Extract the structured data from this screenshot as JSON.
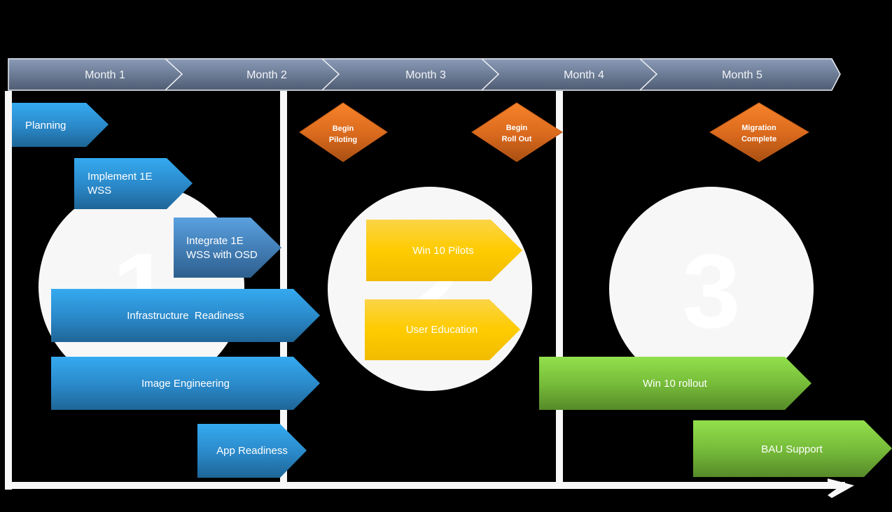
{
  "timeline": {
    "months": [
      "Month 1",
      "Month 2",
      "Month 3",
      "Month 4",
      "Month 5"
    ]
  },
  "phases": [
    {
      "number": "1"
    },
    {
      "number": "2"
    },
    {
      "number": "3"
    }
  ],
  "milestones": [
    {
      "lines": [
        "Begin",
        "Piloting"
      ]
    },
    {
      "lines": [
        "Begin",
        "Roll Out"
      ]
    },
    {
      "lines": [
        "Migration",
        "Complete"
      ]
    }
  ],
  "tasks": [
    {
      "name": "planning",
      "lines": [
        "Planning"
      ],
      "color": "blue",
      "align": "left"
    },
    {
      "name": "implement-1e-wss",
      "lines": [
        "Implement 1E",
        "WSS"
      ],
      "color": "blue",
      "align": "left"
    },
    {
      "name": "integrate-1e-wss-with-osd",
      "lines": [
        "Integrate 1E",
        "WSS with OSD"
      ],
      "color": "steel",
      "align": "left"
    },
    {
      "name": "infrastructure-readiness",
      "lines": [
        "Infrastructure  Readiness"
      ],
      "color": "blue",
      "align": "center"
    },
    {
      "name": "image-engineering",
      "lines": [
        "Image Engineering"
      ],
      "color": "blue",
      "align": "center"
    },
    {
      "name": "app-readiness",
      "lines": [
        "App Readiness"
      ],
      "color": "blue",
      "align": "center"
    },
    {
      "name": "win-10-pilots",
      "lines": [
        "Win 10 Pilots"
      ],
      "color": "yellow",
      "align": "center"
    },
    {
      "name": "user-education",
      "lines": [
        "User Education"
      ],
      "color": "yellow",
      "align": "center"
    },
    {
      "name": "win-10-rollout",
      "lines": [
        "Win 10 rollout"
      ],
      "color": "green",
      "align": "center"
    },
    {
      "name": "bau-support",
      "lines": [
        "BAU Support"
      ],
      "color": "green",
      "align": "center"
    }
  ],
  "colors": {
    "background": "#000000",
    "timeline_top": "#8a9bb8",
    "timeline_bottom": "#4f5d73",
    "blue_top": "#35aaf0",
    "blue_bottom": "#1e6596",
    "steel_top": "#5aa0e0",
    "steel_bottom": "#2d5f8e",
    "yellow_top": "#fcd447",
    "yellow_bottom": "#f1bc00",
    "green_top": "#92e04c",
    "green_bottom": "#568a29",
    "orange_top": "#f7832a",
    "orange_bottom": "#a84f12",
    "frame": "#f7f7f7",
    "circle": "#f7f7f7"
  }
}
